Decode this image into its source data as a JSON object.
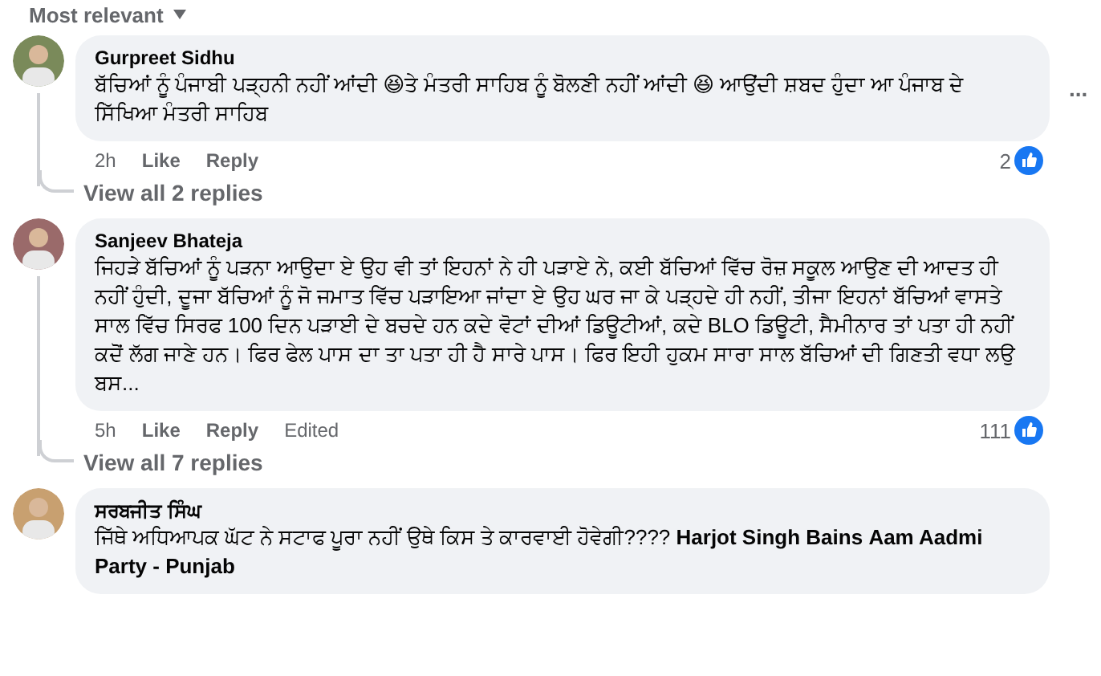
{
  "sort": {
    "label": "Most relevant"
  },
  "comments": [
    {
      "author": "Gurpreet Sidhu",
      "text": "ਬੱਚਿਆਂ ਨੂੰ ਪੰਜਾਬੀ ਪੜ੍ਹਨੀ ਨਹੀਂ ਆਂਦੀ 😆ਤੇ ਮੰਤਰੀ ਸਾਹਿਬ ਨੂੰ ਬੋਲਣੀ ਨਹੀਂ ਆਂਦੀ 😆 ਆਉਂਦੀ ਸ਼ਬਦ ਹੁੰਦਾ ਆ ਪੰਜਾਬ ਦੇ ਸਿੱਖਿਆ ਮੰਤਰੀ ਸਾਹਿਬ",
      "time": "2h",
      "actions": [
        "Like",
        "Reply"
      ],
      "reactions": "2",
      "more": "...",
      "replies": "View all 2 replies"
    },
    {
      "author": "Sanjeev Bhateja",
      "text": "ਜਿਹੜੇ ਬੱਚਿਆਂ ਨੂੰ ਪੜਨਾ ਆਉਦਾ ਏ ਉਹ ਵੀ ਤਾਂ ਇਹਨਾਂ ਨੇ ਹੀ ਪੜਾਏ ਨੇ, ਕਈ ਬੱਚਿਆਂ ਵਿੱਚ ਰੋਜ਼ ਸਕੂਲ ਆਉਣ ਦੀ ਆਦਤ ਹੀ ਨਹੀਂ ਹੁੰਦੀ, ਦੂਜਾ ਬੱਚਿਆਂ ਨੂੰ ਜੋ ਜਮਾਤ ਵਿੱਚ ਪੜਾਇਆ ਜਾਂਦਾ ਏ ਉਹ ਘਰ ਜਾ ਕੇ ਪੜ੍ਹਦੇ ਹੀ ਨਹੀਂ, ਤੀਜਾ ਇਹਨਾਂ ਬੱਚਿਆਂ ਵਾਸਤੇ ਸਾਲ ਵਿੱਚ ਸਿਰਫ 100 ਦਿਨ ਪੜਾਈ ਦੇ ਬਚਦੇ ਹਨ ਕਦੇ ਵੋਟਾਂ ਦੀਆਂ ਡਿਊਟੀਆਂ, ਕਦੇ BLO ਡਿਊਟੀ, ਸੈਮੀਨਾਰ ਤਾਂ ਪਤਾ ਹੀ ਨਹੀਂ ਕਦੋਂ ਲੱਗ ਜਾਣੇ ਹਨ। ਫਿਰ ਫੇਲ ਪਾਸ ਦਾ ਤਾ ਪਤਾ ਹੀ ਹੈ ਸਾਰੇ ਪਾਸ। ਫਿਰ ਇਹੀ ਹੁਕਮ ਸਾਰਾ ਸਾਲ ਬੱਚਿਆਂ ਦੀ ਗਿਣਤੀ ਵਧਾ ਲਉ ਬਸ...",
      "time": "5h",
      "actions": [
        "Like",
        "Reply"
      ],
      "edited": "Edited",
      "reactions": "111",
      "replies": "View all 7 replies"
    },
    {
      "author": "ਸਰਬਜੀਤ ਸਿੰਘ",
      "text": "ਜਿੱਥੇ ਅਧਿਆਪਕ ਘੱਟ ਨੇ ਸਟਾਫ ਪੂਰਾ ਨਹੀਂ ਉਥੇ ਕਿਸ ਤੇ ਕਾਰਵਾਈ ਹੋਵੇਗੀ???? **Harjot Singh Bains** **Aam Aadmi Party - Punjab**"
    }
  ]
}
